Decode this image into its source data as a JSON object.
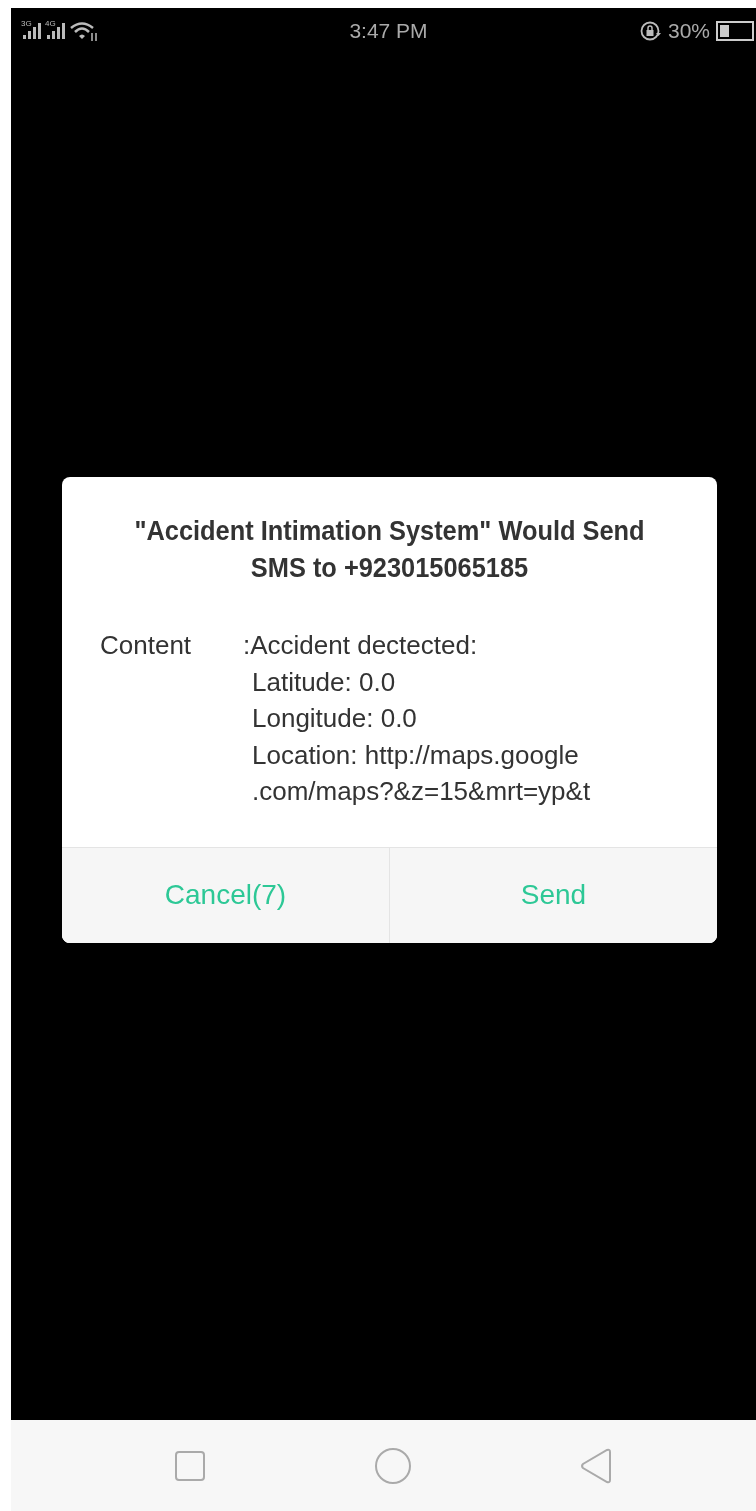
{
  "status_bar": {
    "networks": [
      "3G",
      "4G"
    ],
    "time": "3:47 PM",
    "battery_percent": "30%"
  },
  "dialog": {
    "title": "\"Accident Intimation System\" Would Send SMS to +923015065185",
    "content_label": "Content",
    "content_lines": [
      ":Accident dectected:",
      "Latitude: 0.0",
      "Longitude: 0.0",
      "Location: http://maps.google",
      ".com/maps?&z=15&mrt=yp&t"
    ],
    "buttons": [
      "Cancel(7)",
      "Send"
    ]
  },
  "nav_bar": {
    "buttons": [
      {
        "kind": "recents"
      },
      {
        "kind": "home"
      },
      {
        "kind": "back"
      }
    ]
  }
}
